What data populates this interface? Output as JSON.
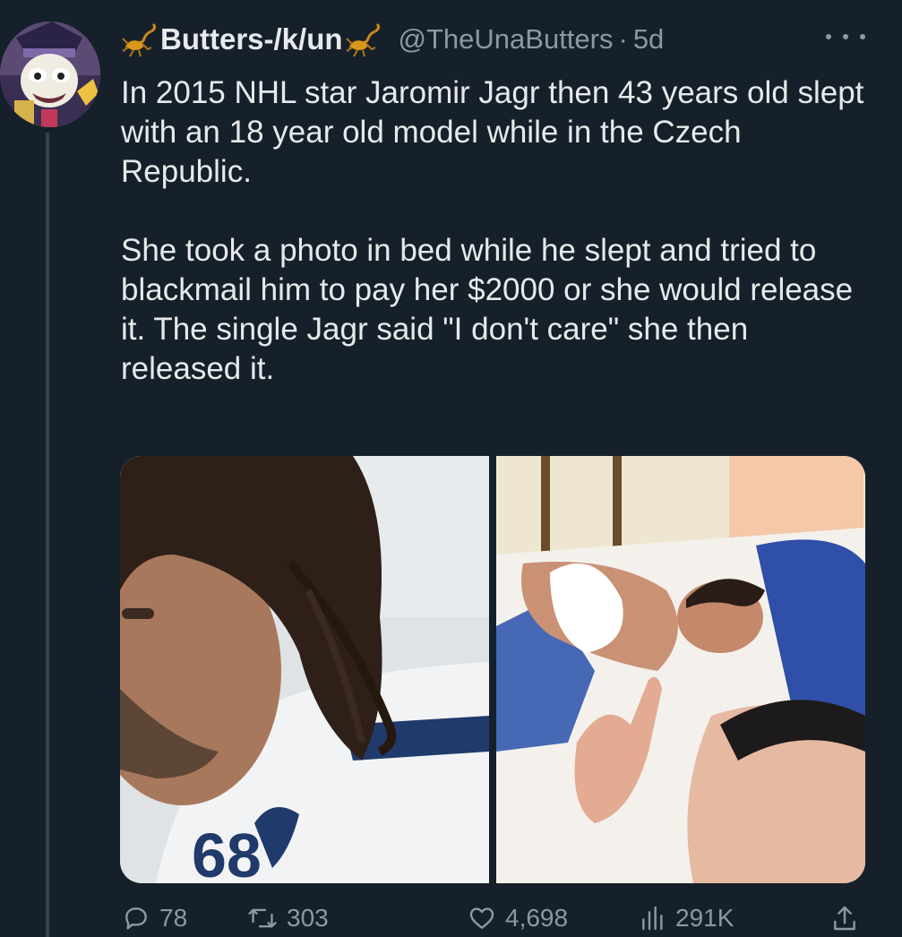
{
  "tweet": {
    "display_name": "Butters-/k/un",
    "handle": "@TheUnaButters",
    "separator": "·",
    "time": "5d",
    "paragraph_1": "In 2015 NHL star Jaromir Jagr then 43 years old slept with an 18 year old model while in the Czech Republic.",
    "paragraph_2": "She took a photo in bed while he slept and tried to blackmail him to pay her $2000 or she would release it. The single Jagr said \"I don't care\" she then released it."
  },
  "icons": {
    "name_decoration": "scorpion-icon",
    "more": "more-icon",
    "reply": "reply-icon",
    "retweet": "retweet-icon",
    "like": "heart-icon",
    "views": "views-icon",
    "share": "share-icon"
  },
  "actions": {
    "replies": "78",
    "retweets": "303",
    "likes": "4,698",
    "views": "291K"
  },
  "colors": {
    "background": "#15202b",
    "text_primary": "#e7e9ea",
    "text_secondary": "#8b98a5",
    "thread_line": "#38444d"
  }
}
